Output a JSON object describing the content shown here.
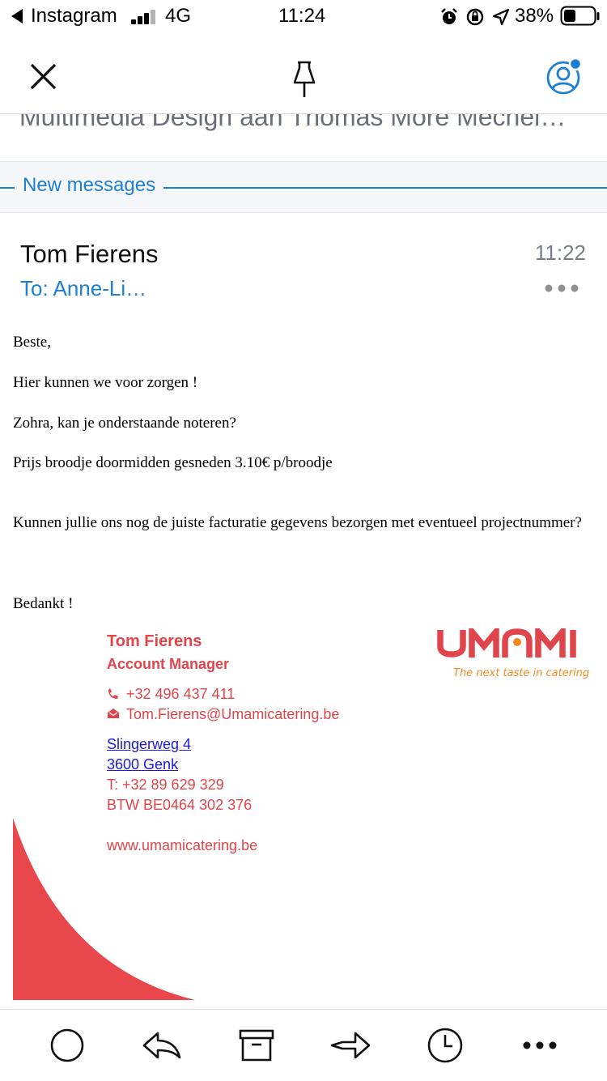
{
  "status_bar": {
    "back_app": "Instagram",
    "network": "4G",
    "time": "11:24",
    "battery": "38%"
  },
  "nav": {
    "close_icon": "close-icon",
    "pin_icon": "pin-icon",
    "account_icon": "account-icon"
  },
  "subject": "Multimedia Design aan Thomas More Mechel…",
  "divider": {
    "label": "New messages"
  },
  "message": {
    "sender": "Tom Fierens",
    "time": "11:22",
    "to": "To: Anne-Li…",
    "more": "•••",
    "body": {
      "greeting": "Beste,",
      "line1": "Hier kunnen we voor zorgen !",
      "line2": "Zohra, kan je onderstaande noteren?",
      "line3": "Prijs broodje doormidden gesneden 3.10€ p/broodje",
      "line4": "Kunnen jullie ons nog de juiste facturatie gegevens bezorgen met eventueel projectnummer?",
      "closing": "Bedankt !"
    },
    "signature": {
      "name": "Tom Fierens",
      "role": "Account Manager",
      "phone": "+32 496 437 411",
      "email": "Tom.Fierens@Umamicatering.be",
      "street": "Slingerweg 4",
      "city": "3600 Genk",
      "tel": "T: +32 89 629 329",
      "vat": "BTW BE0464 302 376",
      "website": "www.umamicatering.be",
      "logo_text": "UMAMI",
      "logo_tagline": "The next taste in catering"
    }
  },
  "colors": {
    "accent": "#1b7fd6",
    "brand_red": "#e0454b",
    "logo_orange": "#f08a1c"
  }
}
